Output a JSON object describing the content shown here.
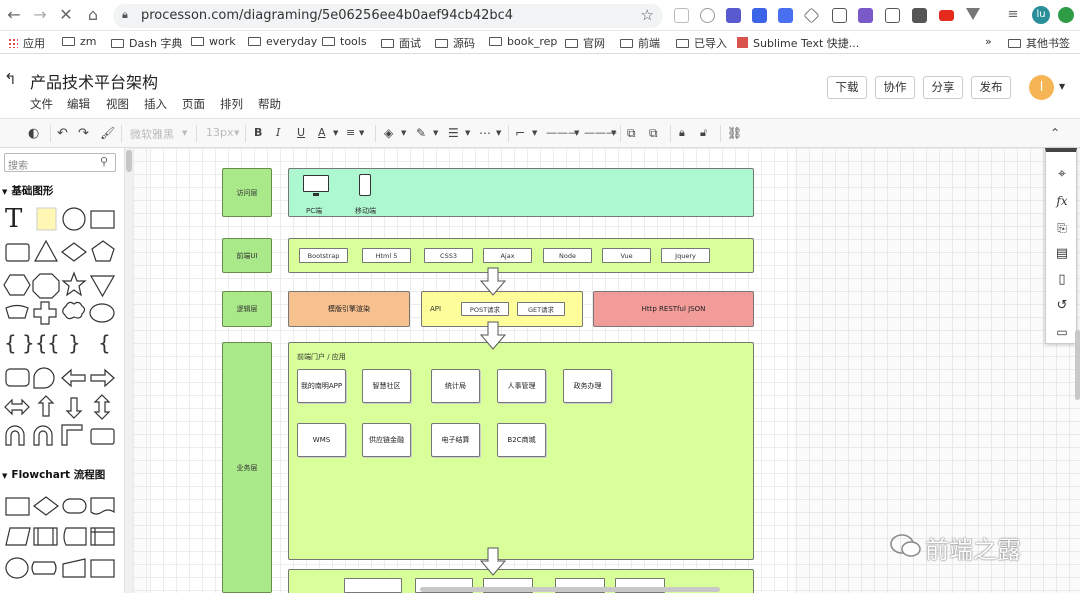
{
  "browser": {
    "url": "processon.com/diagraming/5e06256ee4b0aef94cb42bc4",
    "profile_initials": "lu",
    "bookmarks": [
      "应用",
      "zm",
      "Dash 字典",
      "work",
      "everyday",
      "tools",
      "面试",
      "源码",
      "book_rep",
      "官网",
      "前端",
      "已导入",
      "Sublime Text 快捷..."
    ],
    "more": "»",
    "other_bookmarks": "其他书签"
  },
  "app": {
    "title": "产品技术平台架构",
    "menu": [
      "文件",
      "编辑",
      "视图",
      "插入",
      "页面",
      "排列",
      "帮助"
    ],
    "buttons": {
      "download": "下载",
      "collab": "协作",
      "share": "分享",
      "publish": "发布"
    },
    "avatar_letter": "l"
  },
  "toolbar": {
    "font": "微软雅黑",
    "font_size": "13px"
  },
  "sidebar": {
    "search_placeholder": "搜索",
    "categories": [
      "基础图形",
      "Flowchart 流程图"
    ]
  },
  "diagram": {
    "layers": {
      "access": "访问层",
      "frontend_ui": "前端UI",
      "logic": "逻辑层",
      "business": "业务层"
    },
    "access_items": [
      "PC端",
      "移动端"
    ],
    "frontend_tags": [
      "Bootstrap",
      "Html 5",
      "CSS3",
      "Ajax",
      "Node",
      "Vue",
      "Jquery"
    ],
    "logic": {
      "template": "模版引擎渲染",
      "api": "API",
      "post": "POST请求",
      "get": "GET请求",
      "http": "Http  RESTful  JSON"
    },
    "business": {
      "portal": "前端门户 / 应用",
      "row1": [
        "我的南明APP",
        "智慧社区",
        "统计局",
        "人事管理",
        "政务办理"
      ],
      "row2": [
        "WMS",
        "供应链金融",
        "电子结算",
        "B2C商城"
      ]
    },
    "colors": {
      "layer": "#a9e98a",
      "access_panel": "#adf7d1",
      "ui_panel": "#d8ff9a",
      "template": "#f6c08f",
      "api": "#fdfd99",
      "http": "#f19c99",
      "business": "#d8ff9a"
    }
  },
  "watermark": "前端之露"
}
